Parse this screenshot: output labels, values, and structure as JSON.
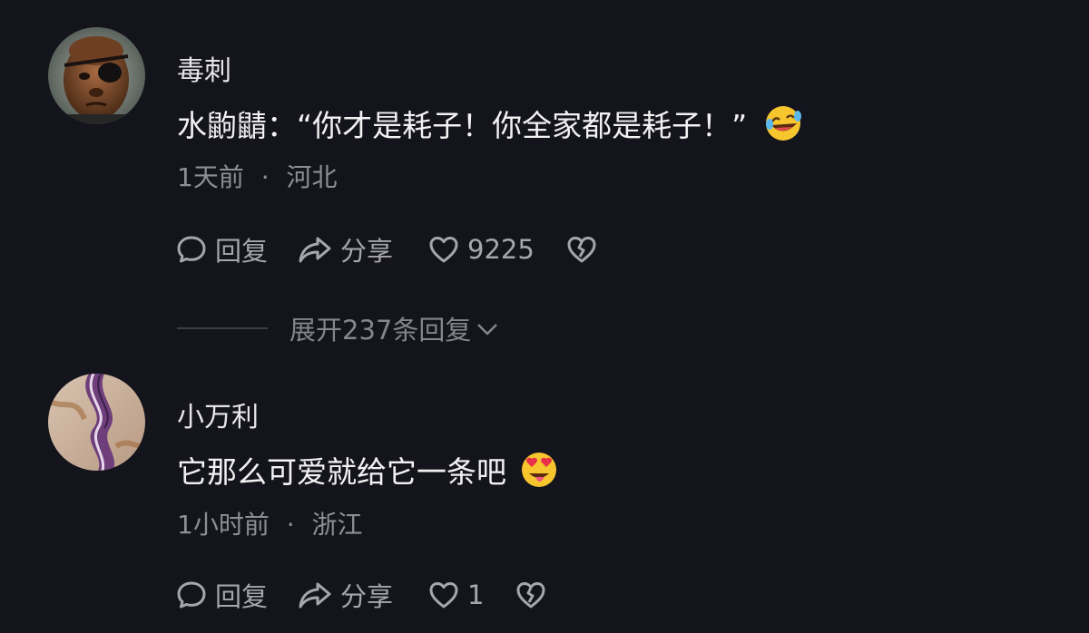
{
  "comments": [
    {
      "username": "毒刺",
      "text": "水鼩鼱：“你才是耗子！你全家都是耗子！”",
      "emoji": "rolling-laughing-emoji",
      "time": "1天前",
      "separator": "·",
      "location": "河北",
      "reply_label": "回复",
      "share_label": "分享",
      "like_count": "9225",
      "expand_label": "展开237条回复"
    },
    {
      "username": "小万利",
      "text": "它那么可爱就给它一条吧",
      "emoji": "heart-eyes-tongue-emoji",
      "time": "1小时前",
      "separator": "·",
      "location": "浙江",
      "reply_label": "回复",
      "share_label": "分享",
      "like_count": "1"
    }
  ],
  "icons": {
    "reply": "comment-bubble-icon",
    "share": "share-arrow-icon",
    "like": "heart-outline-icon",
    "dislike": "broken-heart-icon",
    "expand": "chevron-down-icon"
  },
  "colors": {
    "background": "#14141c",
    "text_primary": "#f2f2f4",
    "text_secondary": "#8e8e96",
    "action_color": "#a6a6ad"
  }
}
